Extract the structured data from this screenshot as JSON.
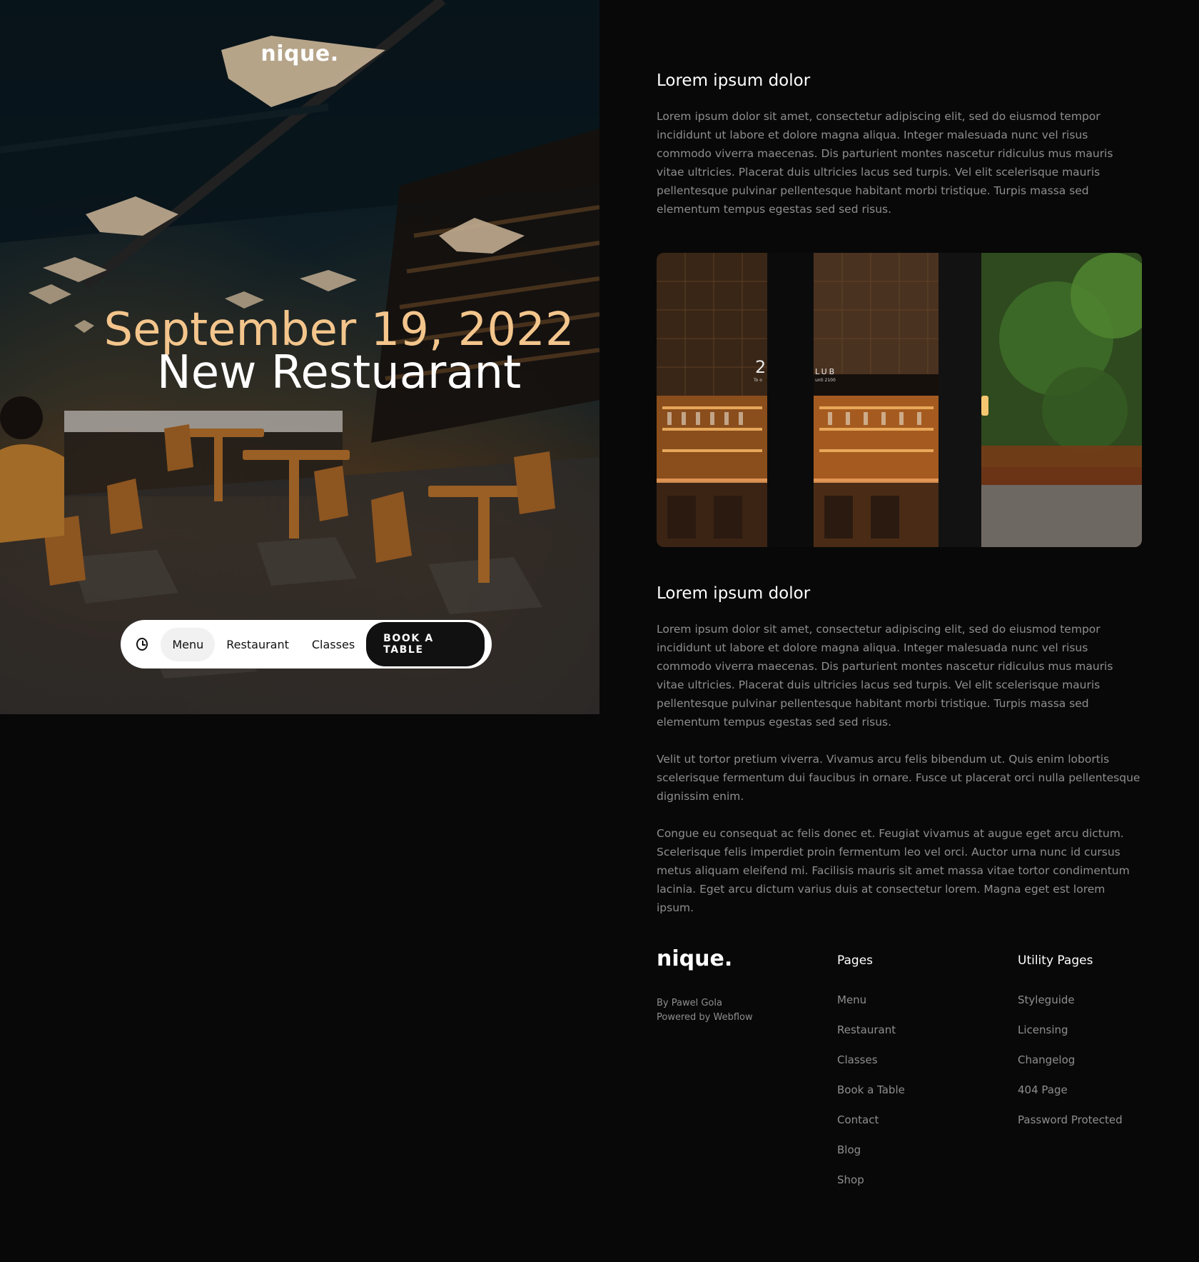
{
  "hero": {
    "logo": "nique.",
    "date": "September 19, 2022",
    "title": "New Restuarant",
    "nav": {
      "clock_icon": "clock-icon",
      "items": [
        "Menu",
        "Restaurant",
        "Classes"
      ],
      "active": "Menu",
      "cta": "BOOK A TABLE"
    }
  },
  "content": {
    "section1": {
      "heading": "Lorem ipsum dolor",
      "paragraph": "Lorem ipsum dolor sit amet, consectetur adipiscing elit, sed do eiusmod tempor incididunt ut labore et dolore magna aliqua. Integer malesuada nunc vel risus commodo viverra maecenas. Dis parturient montes nascetur ridiculus mus mauris vitae ultricies. Placerat duis ultricies lacus sed turpis. Vel elit scelerisque mauris pellentesque pulvinar pellentesque habitant morbi tristique. Turpis massa sed elementum tempus egestas sed sed risus."
    },
    "section2": {
      "heading": "Lorem ipsum dolor",
      "paragraphs": [
        "Lorem ipsum dolor sit amet, consectetur adipiscing elit, sed do eiusmod tempor incididunt ut labore et dolore magna aliqua. Integer malesuada nunc vel risus commodo viverra maecenas. Dis parturient montes nascetur ridiculus mus mauris vitae ultricies. Placerat duis ultricies lacus sed turpis. Vel elit scelerisque mauris pellentesque pulvinar pellentesque habitant morbi tristique. Turpis massa sed elementum tempus egestas sed sed risus.",
        "Velit ut tortor pretium viverra. Vivamus arcu felis bibendum ut. Quis enim lobortis scelerisque fermentum dui faucibus in ornare. Fusce ut placerat orci nulla pellentesque dignissim enim.",
        "Congue eu consequat ac felis donec et. Feugiat vivamus at augue eget arcu dictum. Scelerisque felis imperdiet proin fermentum leo vel orci. Auctor urna nunc id cursus metus aliquam eleifend mi. Facilisis mauris sit amet massa vitae tortor condimentum lacinia. Eget arcu dictum varius duis at consectetur lorem. Magna eget est lorem ipsum."
      ]
    },
    "photo_signage": {
      "number": "2",
      "small_text": "To o",
      "club_text": "LUB",
      "club_sub": "unti 2100"
    }
  },
  "footer": {
    "logo": "nique.",
    "credits": [
      "By Pawel Gola",
      "Powered by Webflow"
    ],
    "pages": {
      "heading": "Pages",
      "links": [
        "Menu",
        "Restaurant",
        "Classes",
        "Book a Table",
        "Contact",
        "Blog",
        "Shop"
      ]
    },
    "utility": {
      "heading": "Utility Pages",
      "links": [
        "Styleguide",
        "Licensing",
        "Changelog",
        "404 Page",
        "Password Protected"
      ]
    }
  },
  "colors": {
    "background": "#080808",
    "date_accent": "#f3c58c",
    "body_text": "#8e8e8e"
  }
}
